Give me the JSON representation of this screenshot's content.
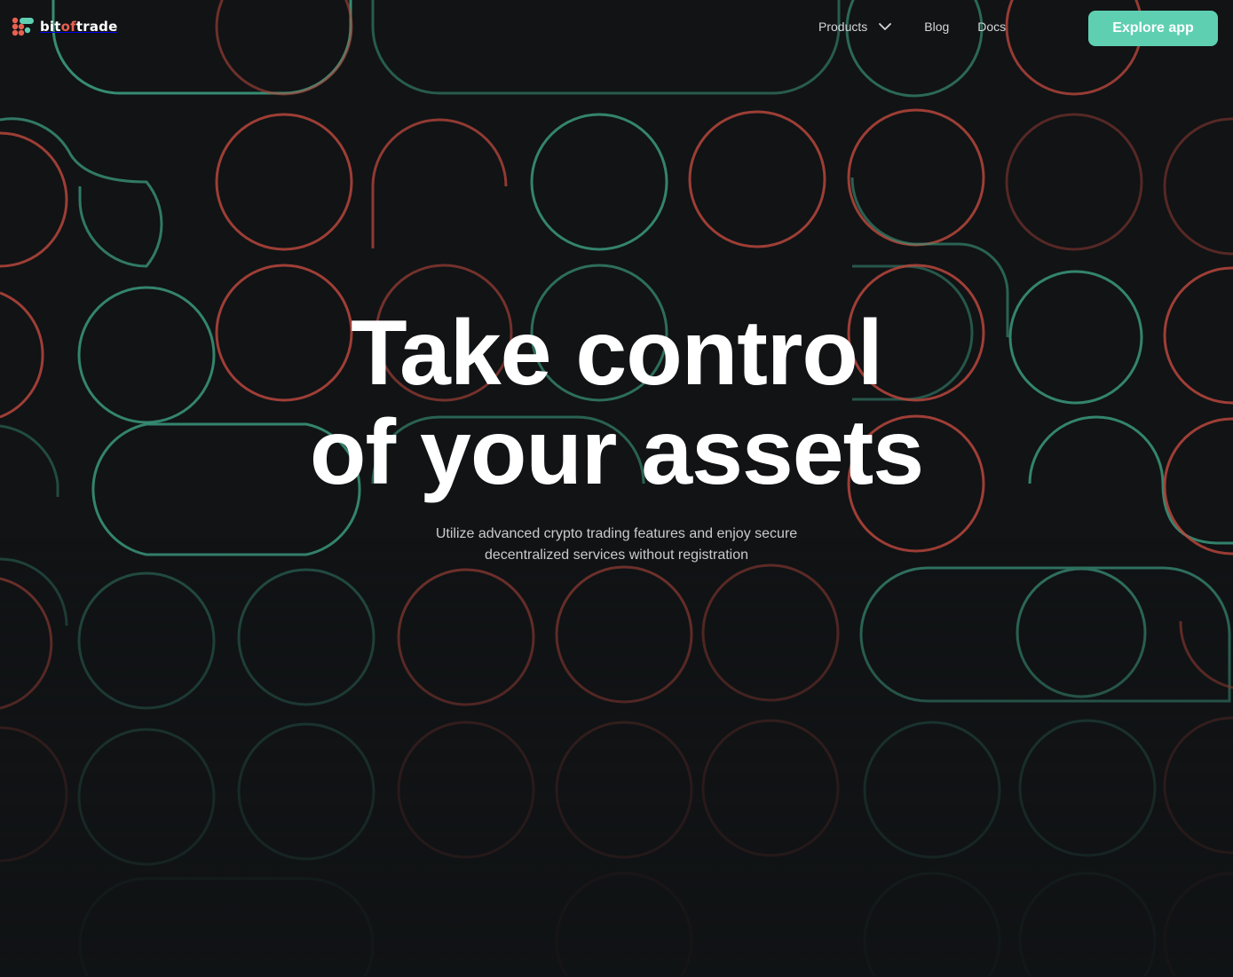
{
  "brand": {
    "name_start": "bit",
    "name_accent": "of",
    "name_end": "trade",
    "accent_color": "#e8604f",
    "mark_colors": [
      "#e8604f",
      "#5fcfb2"
    ]
  },
  "nav": {
    "products_label": "Products",
    "blog_label": "Blog",
    "docs_label": "Docs"
  },
  "cta": {
    "label": "Explore app",
    "color": "#5fcfb2"
  },
  "hero": {
    "title_line1": "Take control",
    "title_line2": "of your assets",
    "subtitle_line1": "Utilize advanced crypto trading features and enjoy secure",
    "subtitle_line2": "decentralized services without registration"
  },
  "colors": {
    "background": "#111315",
    "ring_green": "#3c9a7e",
    "ring_red": "#b8473c"
  }
}
